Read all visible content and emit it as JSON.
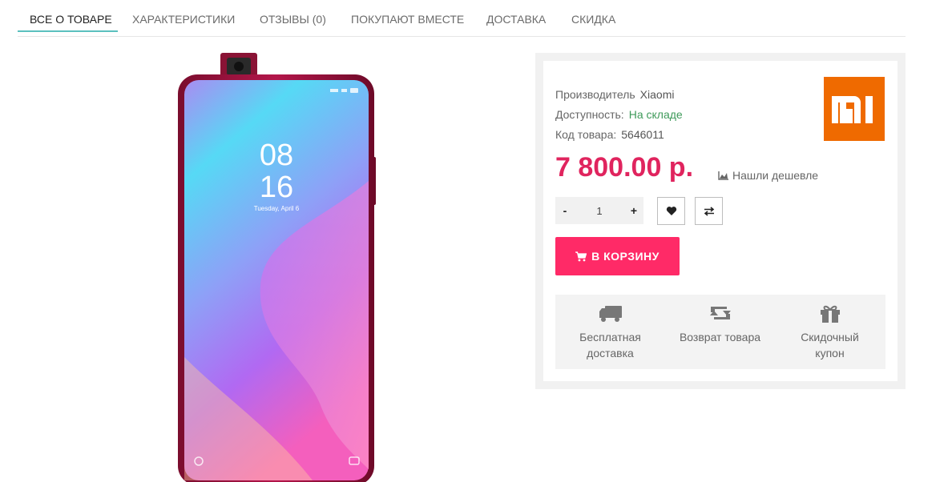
{
  "tabs": [
    {
      "label": "ВСЕ О ТОВАРЕ",
      "active": true
    },
    {
      "label": "ХАРАКТЕРИСТИКИ"
    },
    {
      "label": "ОТЗЫВЫ (0)"
    },
    {
      "label": "ПОКУПАЮТ ВМЕСТЕ"
    },
    {
      "label": "ДОСТАВКА"
    },
    {
      "label": "СКИДКА"
    }
  ],
  "phone": {
    "time_hours": "08",
    "time_minutes": "16",
    "date": "Tuesday, April 6"
  },
  "product": {
    "manufacturer_label": "Производитель",
    "manufacturer": "Xiaomi",
    "availability_label": "Доступность:",
    "availability": "На складе",
    "code_label": "Код товара:",
    "code": "5646011",
    "brand_logo_text": "MI",
    "price": "7 800.00 р.",
    "cheaper_label": "Нашли дешевле",
    "quantity": "1",
    "qty_minus": "-",
    "qty_plus": "+",
    "add_to_cart": "В КОРЗИНУ"
  },
  "benefits": [
    {
      "icon": "truck-icon",
      "line1": "Бесплатная",
      "line2": "доставка"
    },
    {
      "icon": "return-icon",
      "line1": "Возврат товара",
      "line2": ""
    },
    {
      "icon": "gift-icon",
      "line1": "Скидочный",
      "line2": "купон"
    }
  ],
  "colors": {
    "accent": "#ff2a67",
    "price": "#e0245e",
    "in_stock": "#3e9a5a",
    "tab_underline": "#5bc0be",
    "brand": "#ef6a00"
  }
}
